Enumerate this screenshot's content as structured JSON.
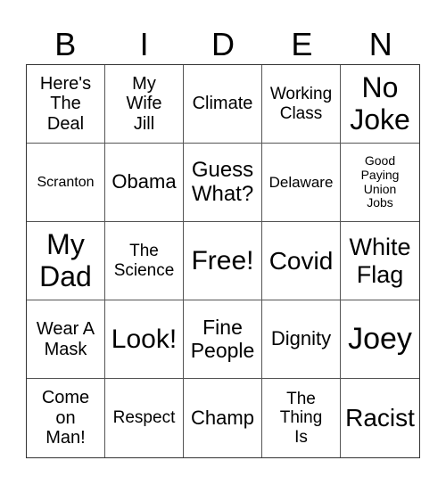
{
  "header": {
    "letters": [
      "B",
      "I",
      "D",
      "E",
      "N"
    ]
  },
  "cells": [
    "Here's\nThe\nDeal",
    "My\nWife\nJill",
    "Climate",
    "Working\nClass",
    "No\nJoke",
    "Scranton",
    "Obama",
    "Guess\nWhat?",
    "Delaware",
    "Good\nPaying\nUnion\nJobs",
    "My\nDad",
    "The\nScience",
    "Free!",
    "Covid",
    "White\nFlag",
    "Wear A\nMask",
    "Look!",
    "Fine\nPeople",
    "Dignity",
    "Joey",
    "Come\non\nMan!",
    "Respect",
    "Champ",
    "The\nThing\nIs",
    "Racist"
  ]
}
